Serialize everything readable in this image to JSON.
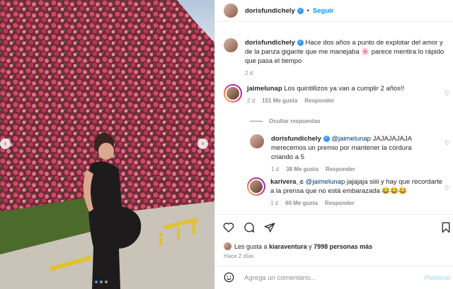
{
  "post": {
    "username": "dorisfundichely",
    "follow_label": "Seguir",
    "caption": "Hace dos años a punto de explotar del amor y de la panza gigante que me manejaba 🌸 parece mentira lo rápido que pasa el tiempo",
    "caption_age": "2 d"
  },
  "comments": [
    {
      "username": "jaimelunap",
      "text": "Los quintillizos ya van a cumplir 2 años!!",
      "age": "2 d",
      "likes": "151 Me gusta",
      "reply_label": "Responder"
    }
  ],
  "hide_replies_label": "Ocultar respuestas",
  "replies": [
    {
      "username": "dorisfundichely",
      "mention": "@jaimelunap",
      "text": "JAJAJAJAJA merecemos un premio por mantener la cordura criando a 5",
      "age": "1 d",
      "likes": "38 Me gusta",
      "reply_label": "Responder"
    },
    {
      "username": "karivera_c",
      "mention": "@jaimelunap",
      "text": "jajajaja siiii y hay que recordarte a la prensa que no está embarazada 😂😂😂",
      "age": "1 d",
      "likes": "60 Me gusta",
      "reply_label": "Responder"
    }
  ],
  "likes_line": {
    "prefix": "Les gusta a",
    "user": "kiaraventura",
    "connector": "y",
    "others": "7998 personas más"
  },
  "post_date": "Hace 2 días",
  "comment_box": {
    "placeholder": "Agrega un comentario...",
    "publish_label": "Publicar"
  },
  "colors": {
    "link_blue": "#0095f6",
    "verified_blue": "#3897f0",
    "muted_gray": "#8e8e8e"
  },
  "icons": [
    "verified-badge-icon",
    "heart-icon",
    "comment-icon",
    "share-icon",
    "bookmark-icon",
    "emoji-icon",
    "chevron-left-icon",
    "chevron-right-icon"
  ]
}
